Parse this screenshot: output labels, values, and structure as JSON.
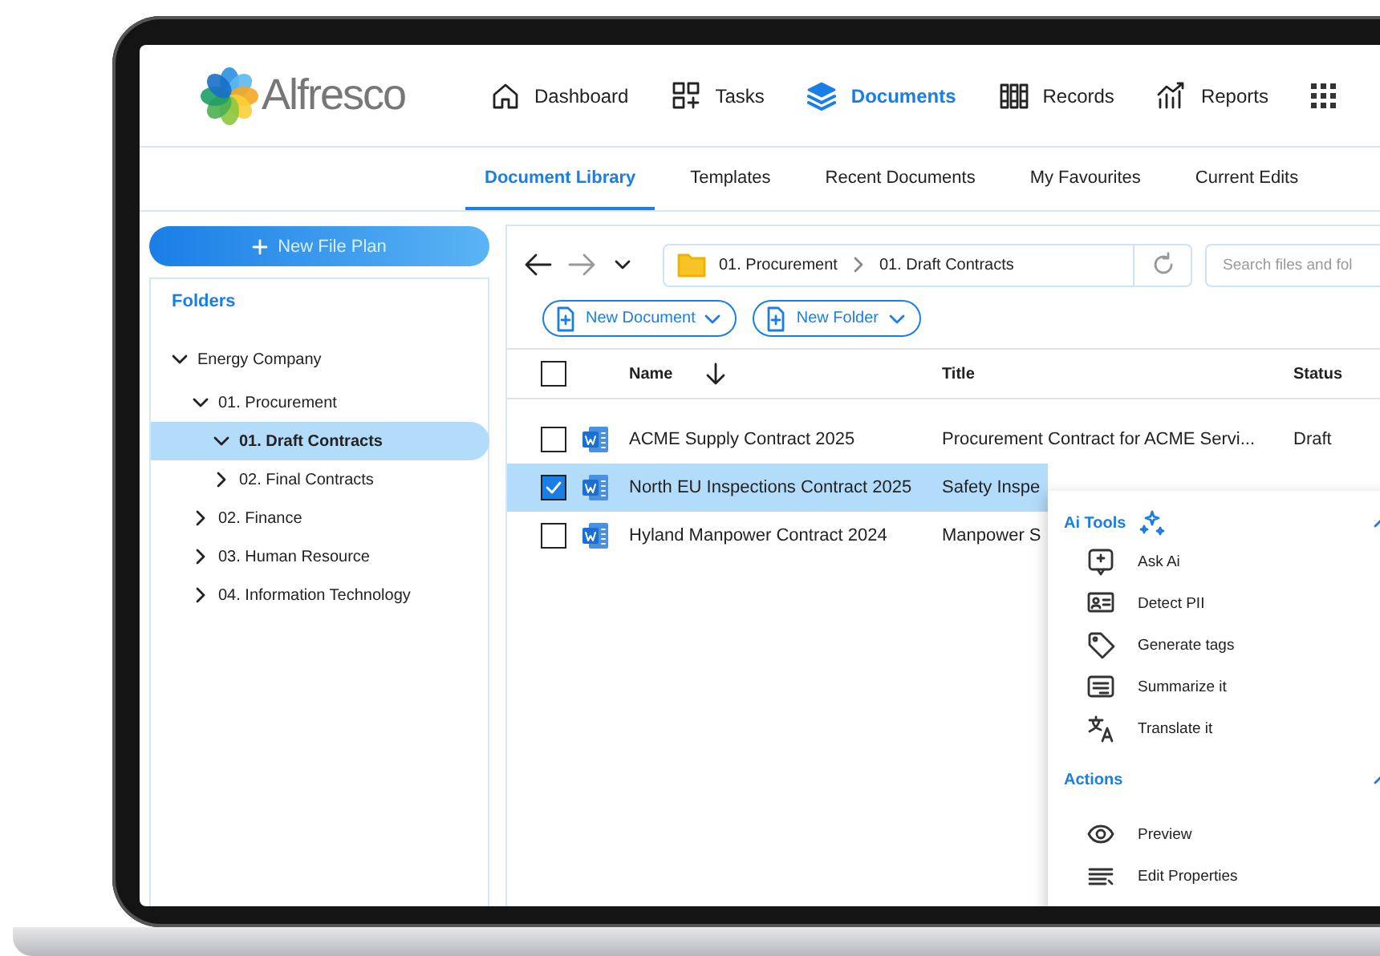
{
  "app": {
    "logo": "Alfresco"
  },
  "nav": [
    {
      "label": "Dashboard",
      "selected": false
    },
    {
      "label": "Tasks",
      "selected": false
    },
    {
      "label": "Documents",
      "selected": true
    },
    {
      "label": "Records",
      "selected": false
    },
    {
      "label": "Reports",
      "selected": false
    }
  ],
  "subtabs": [
    {
      "label": "Document Library",
      "selected": true
    },
    {
      "label": "Templates",
      "selected": false
    },
    {
      "label": "Recent Documents",
      "selected": false
    },
    {
      "label": "My Favourites",
      "selected": false
    },
    {
      "label": "Current Edits",
      "selected": false
    }
  ],
  "sidebar": {
    "new_button": "New File Plan",
    "folders_title": "Folders",
    "tree": [
      {
        "label": "Energy Company",
        "expanded": true,
        "selected": false,
        "children": [
          {
            "label": "01. Procurement",
            "expanded": true,
            "selected": false,
            "children": [
              {
                "label": "01. Draft Contracts",
                "expanded": true,
                "selected": true
              },
              {
                "label": "02. Final Contracts",
                "expanded": false,
                "selected": false
              }
            ]
          },
          {
            "label": "02. Finance",
            "expanded": false,
            "selected": false
          },
          {
            "label": "03. Human Resource",
            "expanded": false,
            "selected": false
          },
          {
            "label": "04. Information Technology",
            "expanded": false,
            "selected": false
          }
        ]
      }
    ]
  },
  "browser": {
    "breadcrumb": [
      "01. Procurement",
      "01. Draft Contracts"
    ],
    "search": {
      "placeholder": "Search files and fol"
    },
    "buttons": [
      "New Document",
      "New Folder"
    ],
    "select_all": {
      "checked": false
    },
    "columns": [
      "Name",
      "Title",
      "Status"
    ],
    "rows": [
      {
        "name": "ACME Supply Contract 2025",
        "title": "Procurement Contract for ACME Servi...",
        "status": "Draft",
        "selected": false
      },
      {
        "name": "North EU Inspections Contract 2025",
        "title": "Safety Inspe",
        "selected": true
      },
      {
        "name": "Hyland Manpower Contract 2024",
        "title": "Manpower S",
        "selected": false
      }
    ]
  },
  "context_menu": {
    "sections": [
      {
        "title": "Ai Tools",
        "expanded": true,
        "items": [
          {
            "label": "Ask Ai"
          },
          {
            "label": "Detect PII"
          },
          {
            "label": "Generate tags"
          },
          {
            "label": "Summarize it"
          },
          {
            "label": "Translate it"
          }
        ]
      },
      {
        "title": "Actions",
        "expanded": true,
        "items": [
          {
            "label": "Preview"
          },
          {
            "label": "Edit Properties"
          }
        ]
      }
    ]
  }
}
